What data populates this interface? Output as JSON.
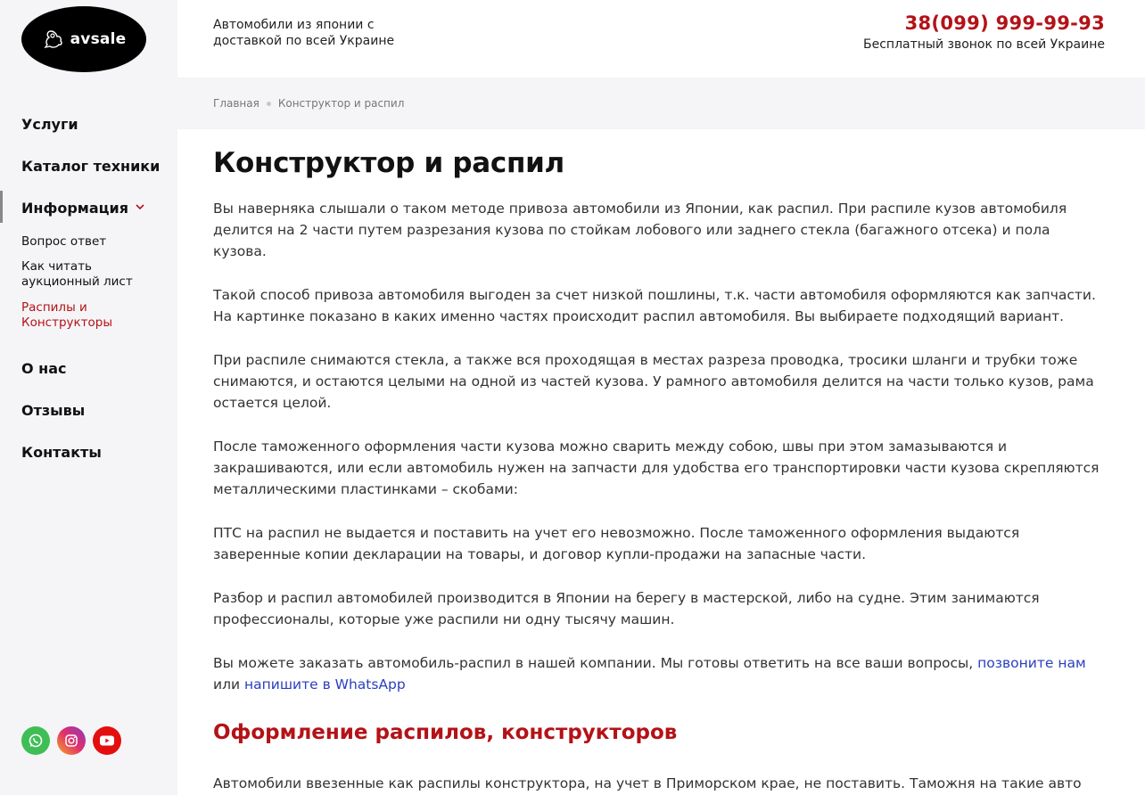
{
  "logo": {
    "text": "avsale"
  },
  "sidebar": {
    "nav": [
      {
        "label": "Услуги"
      },
      {
        "label": "Каталог техники"
      },
      {
        "label": "Информация"
      },
      {
        "label": "О нас"
      },
      {
        "label": "Отзывы"
      },
      {
        "label": "Контакты"
      }
    ],
    "sub": [
      {
        "label": "Вопрос ответ"
      },
      {
        "label": "Как читать аукционный лист"
      },
      {
        "label": "Распилы и Конструкторы"
      }
    ]
  },
  "header": {
    "tagline": "Автомобили из японии с доставкой по всей Украине",
    "phone": "38(099) 999-99-93",
    "phone_sub": "Бесплатный звонок по всей Украине"
  },
  "breadcrumb": {
    "home": "Главная",
    "current": "Конструктор и распил"
  },
  "main": {
    "title": "Конструктор и распил",
    "paragraphs": [
      "Вы наверняка слышали о таком методе привоза автомобили из Японии, как распил. При распиле кузов автомобиля делится на 2 части путем разрезания кузова по стойкам лобового или заднего стекла (багажного отсека) и пола кузова.",
      "Такой способ привоза автомобиля выгоден за счет низкой пошлины, т.к. части автомобиля оформляются как запчасти. На картинке показано в каких именно частях происходит распил автомобиля. Вы выбираете подходящий вариант.",
      "При распиле снимаются стекла, а также вся проходящая в местах разреза проводка, тросики шланги и трубки тоже снимаются, и остаются целыми на одной из частей кузова. У рамного автомобиля делится на части только кузов, рама остается целой.",
      "После таможенного оформления части кузова можно сварить между собою, швы при этом замазываются и закрашиваются, или если автомобиль нужен на запчасти для удобства его транспортировки части кузова скрепляются металлическими пластинками – скобами:",
      "ПТС на распил не выдается и поставить на учет его невозможно. После таможенного оформления выдаются заверенные копии декларации на товары, и договор купли-продажи на запасные части.",
      "Разбор и распил автомобилей производится в Японии на берегу в мастерской, либо на судне. Этим занимаются профессионалы, которые уже распили ни одну тысячу машин."
    ],
    "contact_text_1": "Вы можете заказать автомобиль-распил в нашей компании. Мы готовы ответить на все ваши вопросы,",
    "contact_link_call": "позвоните нам",
    "contact_text_2": "или",
    "contact_link_whatsapp": "напишите в WhatsApp",
    "subtitle": "Оформление распилов, конструкторов",
    "last_paragraph": "Автомобили ввезенные как распилы конструктора, на учет в Приморском крае, не поставить. Таможня на такие авто"
  },
  "socials": {
    "icons": [
      "whatsapp-icon",
      "instagram-icon",
      "youtube-icon"
    ]
  },
  "colors": {
    "accent": "#b31217",
    "link": "#2a3fbf",
    "sidebar_bg": "#f5f5f7"
  }
}
